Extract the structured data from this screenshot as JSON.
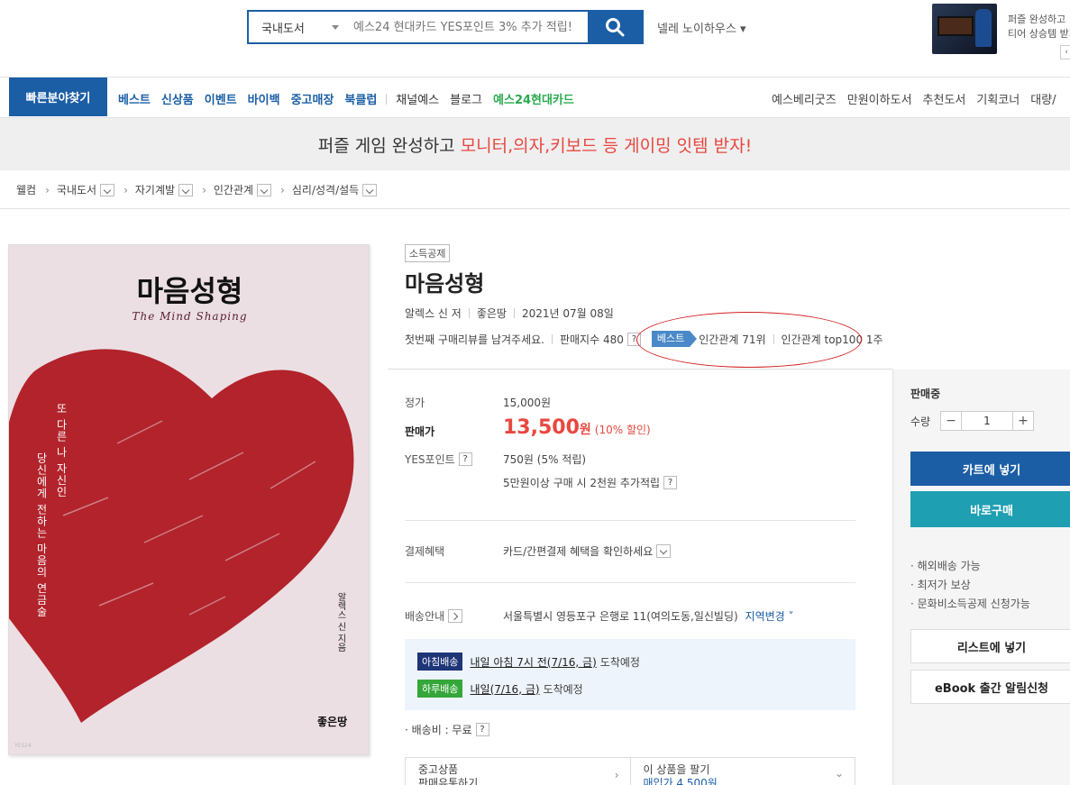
{
  "header": {
    "search_category": "국내도서",
    "search_placeholder": "예스24 현대카드 YES포인트 3% 추가 적립!",
    "user_name": "넬레 노이하우스 ▾",
    "banner_line1": "퍼즐 완성하고",
    "banner_line2": "티어 상승템 받지",
    "banner_scroll": "‹"
  },
  "nav": {
    "quick_find": "빠른분야찾기",
    "links_blue": [
      "베스트",
      "신상품",
      "이벤트",
      "바이백",
      "중고매장",
      "북클럽"
    ],
    "links_dark": [
      "채널예스",
      "블로그"
    ],
    "link_green": "예스24현대카드",
    "right": [
      "예스베리굿즈",
      "만원이하도서",
      "추천도서",
      "기획코너",
      "대량/"
    ]
  },
  "promo": {
    "text_plain": "퍼즐 게임 완성하고 ",
    "text_highlight": "모니터,의자,키보드 등 게이밍 잇템 받자!"
  },
  "breadcrumb": [
    "웰컴",
    "국내도서",
    "자기계발",
    "인간관계",
    "심리/성격/설득"
  ],
  "cover": {
    "title": "마음성형",
    "subtitle": "The Mind Shaping",
    "vert1": "또 다른 나 자신인",
    "vert2": "당신에게 전하는 마음의 연금술",
    "author": "알렉스 신 지음",
    "publisher": "좋은땅",
    "watermark": "YES24"
  },
  "product": {
    "tag": "소득공제",
    "title": "마음성형",
    "author": "알렉스 신 저",
    "publisher": "좋은땅",
    "date": "2021년 07월 08일",
    "review_prompt": "첫번째 구매리뷰를 남겨주세요.",
    "sales_index": "판매지수 480",
    "best_badge": "베스트",
    "rank1": "인간관계 71위",
    "rank2": "인간관계 top100 1주",
    "qmark": "?"
  },
  "price": {
    "list_label": "정가",
    "list_value": "15,000원",
    "sale_label": "판매가",
    "sale_value": "13,500",
    "sale_unit": "원",
    "discount": "(10% 할인)",
    "point_label": "YES포인트",
    "point_value": "750원 (5% 적립)",
    "extra_point": "5만원이상 구매 시 2천원 추가적립"
  },
  "payment": {
    "label": "결제혜택",
    "value": "카드/간편결제 혜택을 확인하세요"
  },
  "shipping": {
    "label": "배송안내",
    "address": "서울특별시 영등포구 은행로 11(여의도동,일신빌딩)",
    "change": "지역변경 ˅",
    "morning_tag": "아침배송",
    "morning_text": "내일 아침 7시 전(7/16, 금)",
    "morning_suffix": "도착예정",
    "day_tag": "하루배송",
    "day_text": "내일(7/16, 금)",
    "day_suffix": "도착예정",
    "fee": "· 배송비 : 무료"
  },
  "used": {
    "left_line1": "중고상품",
    "left_line2": "판매유통하기",
    "right_line1": "이 상품을 팔기",
    "right_line2": "매입가 4,500원"
  },
  "side": {
    "status": "판매중",
    "qty_label": "수량",
    "qty_value": "1",
    "minus": "−",
    "plus": "+",
    "cart": "카트에 넣기",
    "buy_now": "바로구매",
    "bullets": [
      "· 해외배송 가능",
      "· 최저가 보상",
      "· 문화비소득공제 신청가능"
    ],
    "wishlist": "리스트에 넣기",
    "ebook": "eBook 출간 알림신청"
  },
  "colors": {
    "brand": "#1b5ea5",
    "accent_red": "#e8473f",
    "teal": "#1f9fb2",
    "green": "#2aab4e",
    "heart": "#b2232b"
  }
}
